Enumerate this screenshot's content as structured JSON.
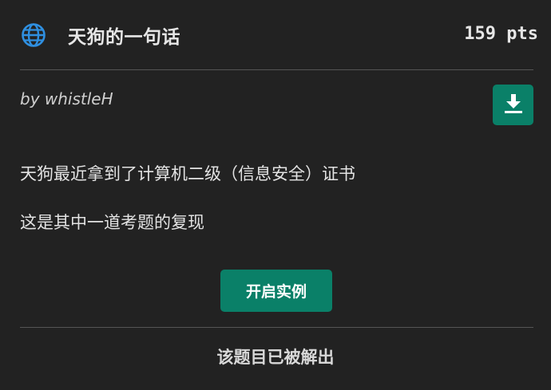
{
  "header": {
    "icon": "globe-icon",
    "title": "天狗的一句话",
    "points": "159 pts"
  },
  "author": "by whistleH",
  "download": {
    "icon": "download-icon"
  },
  "description": [
    "天狗最近拿到了计算机二级（信息安全）证书",
    "这是其中一道考题的复现"
  ],
  "actions": {
    "start_instance": "开启实例"
  },
  "footer": {
    "status": "该题目已被解出"
  },
  "colors": {
    "accent": "#0a8068",
    "background": "#222222",
    "globe": "#2f8fe0"
  }
}
